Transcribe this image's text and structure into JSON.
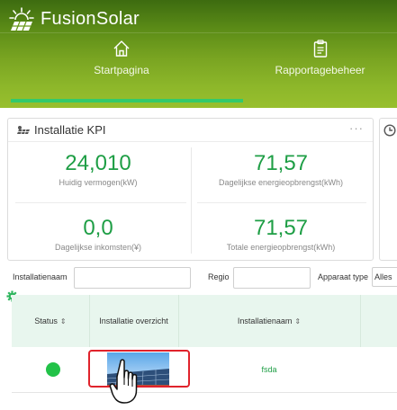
{
  "app": {
    "name": "FusionSolar",
    "logo_icon": "fusionsolar-sun-logo"
  },
  "nav": {
    "items": [
      {
        "label": "Startpagina",
        "icon": "home-icon",
        "active": true
      },
      {
        "label": "Rapportagebeheer",
        "icon": "report-clipboard-icon",
        "active": false
      }
    ],
    "active_color": "#33c96b"
  },
  "kpi": {
    "title": "Installatie KPI",
    "more": "···",
    "items": [
      {
        "value": "24,010",
        "label": "Huidig vermogen(kW)"
      },
      {
        "value": "71,57",
        "label": "Dagelijkse energieopbrengst(kWh)"
      },
      {
        "value": "0,0",
        "label": "Dagelijkse inkomsten(¥)"
      },
      {
        "value": "71,57",
        "label": "Totale energieopbrengst(kWh)"
      }
    ],
    "value_color": "#1e9e45"
  },
  "filters": {
    "installation_name_label": "Installatienaam",
    "installation_name_value": "",
    "region_label": "Regio",
    "region_value": "",
    "device_type_label": "Apparaat type",
    "device_type_value": "Alles"
  },
  "table": {
    "columns": [
      {
        "label": "Status",
        "sortable": true
      },
      {
        "label": "Installatie overzicht",
        "sortable": false
      },
      {
        "label": "Installatienaam",
        "sortable": true
      }
    ],
    "sort_glyph": "⇕",
    "rows": [
      {
        "status": "online",
        "status_color": "#22c248",
        "overview": "solar-panel-thumbnail",
        "name": "fsda"
      }
    ]
  }
}
